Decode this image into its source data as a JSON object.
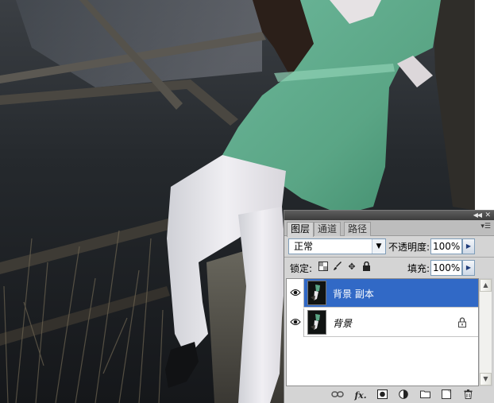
{
  "panel": {
    "tabs": [
      {
        "label": "图层",
        "active": true
      },
      {
        "label": "通道",
        "active": false
      },
      {
        "label": "路径",
        "active": false
      }
    ],
    "blend_mode": "正常",
    "opacity_label": "不透明度:",
    "opacity_value": "100%",
    "lock_label": "锁定:",
    "fill_label": "填充:",
    "fill_value": "100%",
    "layers": [
      {
        "name": "背景 副本",
        "selected": true,
        "visible": true,
        "locked": false
      },
      {
        "name": "背景",
        "selected": false,
        "visible": true,
        "locked": true
      }
    ],
    "icons": {
      "collapse": "double-chevron-right-icon",
      "close": "close-icon",
      "menu": "panel-menu-icon",
      "eye": "eye-icon",
      "lock": "lock-icon",
      "link": "link-icon",
      "fx": "fx-icon",
      "mask": "mask-icon",
      "adjust": "adjustment-icon",
      "group": "folder-icon",
      "new_layer": "new-layer-icon",
      "trash": "trash-icon"
    },
    "bottom_fx_label": "fx.",
    "colors": {
      "selection": "#3169c6",
      "panel_bg": "#d4d4d4"
    }
  }
}
